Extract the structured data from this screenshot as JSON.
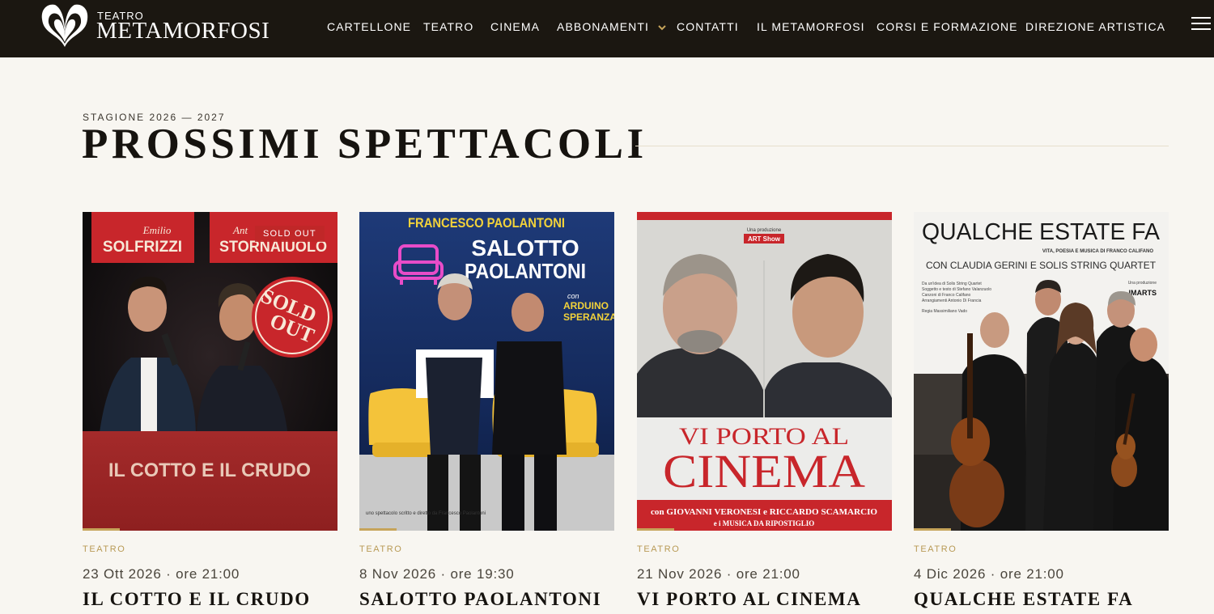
{
  "brand": {
    "small": "TEATRO",
    "name": "METAMORFOSI"
  },
  "nav": {
    "items": [
      {
        "label": "CARTELLONE"
      },
      {
        "label": "TEATRO"
      },
      {
        "label": "CINEMA"
      },
      {
        "label": "ABBONAMENTI",
        "has_dropdown": true
      },
      {
        "label": "CONTATTI"
      },
      {
        "label": "IL METAMORFOSI"
      },
      {
        "label": "CORSI E FORMAZIONE"
      },
      {
        "label": "DIREZIONE ARTISTICA"
      }
    ],
    "menu_icon": "hamburger-menu-icon",
    "dropdown_icon": "chevron-down-icon"
  },
  "section": {
    "eyebrow": "STAGIONE 2026 — 2027",
    "title": "PROSSIMI SPETTACOLI"
  },
  "colors": {
    "header_bg": "#1b1711",
    "page_bg": "#f8f6f1",
    "accent_gold": "#c6a45a",
    "sold_out_red": "#c8262b"
  },
  "cards": [
    {
      "category": "TEATRO",
      "date": "23 Ott 2026 · ore 21:00",
      "title": "IL COTTO E IL CRUDO",
      "badge": "SOLD OUT",
      "poster": {
        "name_left_first": "Emilio",
        "name_left_last": "SOLFRIZZI",
        "name_right_first": "Ant",
        "name_right_last": "STORNAIUOLO",
        "stamp_line1": "SOLD",
        "stamp_line2": "OUT",
        "show_title": "IL COTTO E IL CRUDO"
      }
    },
    {
      "category": "TEATRO",
      "date": "8 Nov 2026 · ore 19:30",
      "title": "SALOTTO PAOLANTONI",
      "poster": {
        "top_name": "FRANCESCO PAOLANTONI",
        "title_line1": "SALOTTO",
        "title_line2": "PAOLANTONI",
        "con": "con",
        "guest1": "ARDUINO",
        "guest2": "SPERANZA",
        "credit": "uno spettacolo scritto e diretto da Francesco Paolantoni"
      }
    },
    {
      "category": "TEATRO",
      "date": "21 Nov 2026 · ore 21:00",
      "title": "VI PORTO AL CINEMA",
      "poster": {
        "producer_label": "Una produzione",
        "producer": "ART Show",
        "title_line1": "VI PORTO AL",
        "title_line2": "CINEMA",
        "cast": "con GIOVANNI VERONESI e RICCARDO SCAMARCIO",
        "music": "e i MUSICA DA RIPOSTIGLIO"
      }
    },
    {
      "category": "TEATRO",
      "date": "4 Dic 2026 · ore 21:00",
      "title": "QUALCHE ESTATE FA",
      "poster": {
        "title": "QUALCHE ESTATE FA",
        "subtitle": "VITA, POESIA E MUSICA DI FRANCO CALIFANO",
        "cast": "CON CLAUDIA GERINI E SOLIS STRING QUARTET",
        "credits_1": "Da un'idea di Solis String Quartet",
        "credits_2": "Soggetto e testo di Stefano Valanzuolo",
        "credits_3": "Canzoni di Franco Califano",
        "credits_4": "Arrangiamenti Antonio Di Francia",
        "credits_5": "Regia Massimiliano Vado",
        "producer_label": "Una produzione",
        "producer": "IMARTS"
      }
    }
  ]
}
